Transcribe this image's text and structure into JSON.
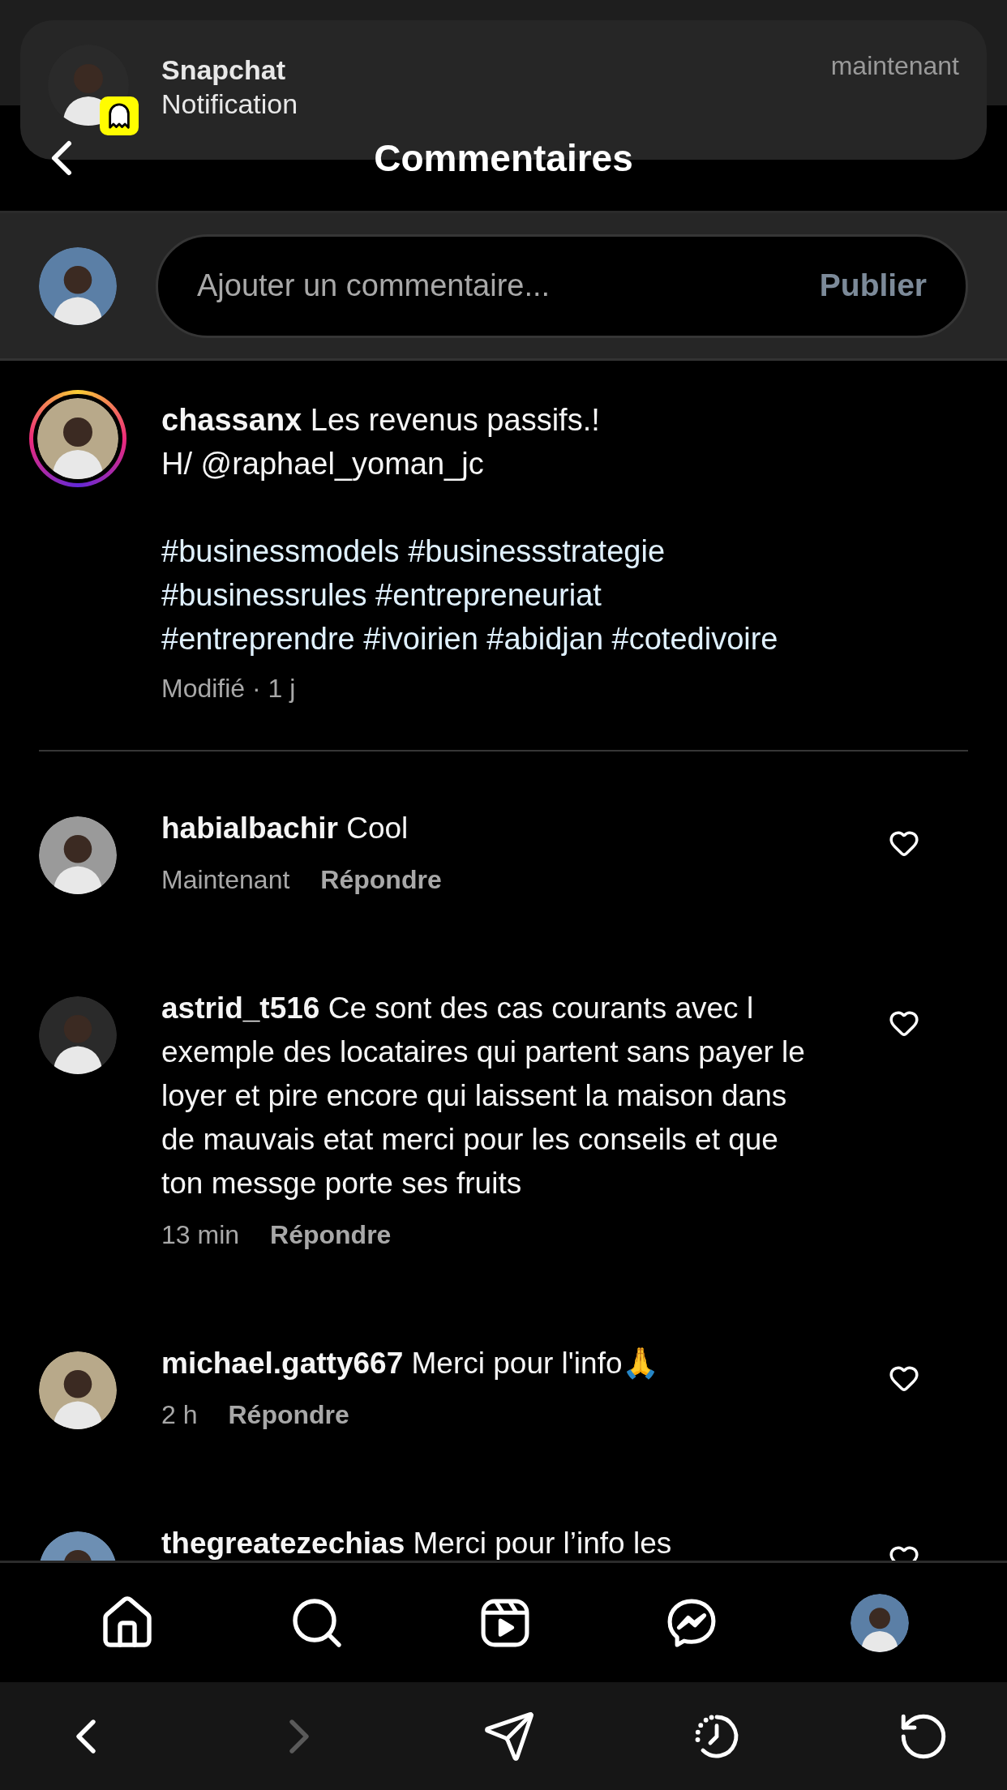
{
  "notification": {
    "app": "Snapchat",
    "text": "Notification",
    "time": "maintenant"
  },
  "header": {
    "title": "Commentaires"
  },
  "composer": {
    "placeholder": "Ajouter un commentaire...",
    "action": "Publier"
  },
  "caption": {
    "username": "chassanx",
    "has_story": true,
    "lines": [
      "Les revenus passifs.!",
      "H/ @raphael_yoman_jc"
    ],
    "hashtag_lines": [
      "#businessmodels #businessstrategie",
      "#businessrules #entrepreneuriat",
      "#entreprendre #ivoirien #abidjan #cotedivoire"
    ],
    "meta": "Modifié · 1 j"
  },
  "comments": [
    {
      "username": "habialbachir",
      "text": "Cool",
      "time": "Maintenant",
      "reply": "Répondre",
      "liked": false
    },
    {
      "username": "astrid_t516",
      "text": "Ce sont des cas courants avec l exemple des locataires qui partent sans payer le loyer et pire encore qui laissent la maison dans de mauvais etat merci pour les conseils et que ton messge porte ses fruits",
      "time": "13 min",
      "reply": "Répondre",
      "liked": false
    },
    {
      "username": "michael.gatty667",
      "text": "Merci pour l'info🙏",
      "time": "2 h",
      "reply": "Répondre",
      "liked": false
    },
    {
      "username": "thegreatezechias",
      "text": "Merci pour l’info les",
      "liked": false
    }
  ],
  "browser_bar": {
    "back_enabled": true,
    "forward_enabled": false
  }
}
